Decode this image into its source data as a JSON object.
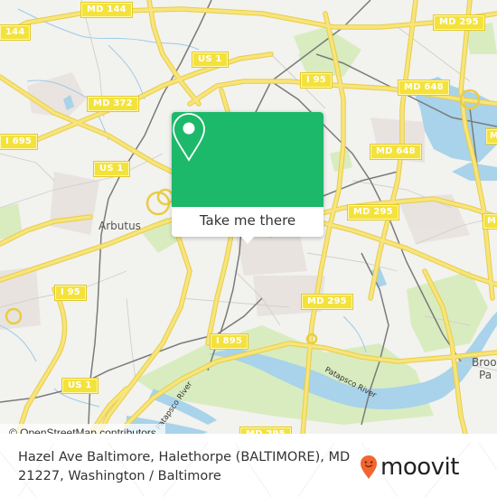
{
  "map": {
    "colors": {
      "background": "#f2f2ef",
      "road": "#f6e37a",
      "road_casing": "#e9cf45",
      "water": "#a8d3ea",
      "park": "#d9ecc0",
      "rail": "#777777",
      "landuse": "#e8e2e0",
      "shield": "#f4e23c"
    },
    "road_labels": [
      {
        "id": "md144-top",
        "text": "MD 144"
      },
      {
        "id": "md144-left",
        "text": "144"
      },
      {
        "id": "us1-top",
        "text": "US 1"
      },
      {
        "id": "md372",
        "text": "MD 372"
      },
      {
        "id": "i695",
        "text": "I 695"
      },
      {
        "id": "us1-mid",
        "text": "US 1"
      },
      {
        "id": "i95-top",
        "text": "I 95"
      },
      {
        "id": "md295-top",
        "text": "MD 295"
      },
      {
        "id": "md648-top",
        "text": "MD 648"
      },
      {
        "id": "md648-mid",
        "text": "MD 648"
      },
      {
        "id": "md295-mid",
        "text": "MD 295"
      },
      {
        "id": "i95-left",
        "text": "I 95"
      },
      {
        "id": "md295-low",
        "text": "MD 295"
      },
      {
        "id": "i895",
        "text": "I 895"
      },
      {
        "id": "us1-low",
        "text": "US 1"
      },
      {
        "id": "md295-bottom",
        "text": "MD 295"
      },
      {
        "id": "md-right-1",
        "text": "MD"
      },
      {
        "id": "md-right-2",
        "text": "MD"
      }
    ],
    "place_labels": [
      {
        "id": "arbutus",
        "text": "Arbutus"
      },
      {
        "id": "brooklyn-park",
        "text": "Brooklyn Park",
        "visible_text_line1": "Broo",
        "visible_text_line2": "Pa"
      }
    ],
    "water_labels": [
      {
        "id": "patapsco-river-1",
        "text": "Patapsco River"
      },
      {
        "id": "patapsco-river-2",
        "text": "Patapsco River"
      }
    ],
    "attribution": "© OpenStreetMap contributors"
  },
  "popup": {
    "icon": "map-pin-icon",
    "button_label": "Take me there",
    "accent_color": "#1db96a"
  },
  "footer": {
    "address": "Hazel Ave Baltimore, Halethorpe (BALTIMORE), MD 21227, Washington / Baltimore",
    "brand": "moovit",
    "brand_icon": "moovit-pin-logo-icon",
    "brand_color": "#f26531"
  }
}
